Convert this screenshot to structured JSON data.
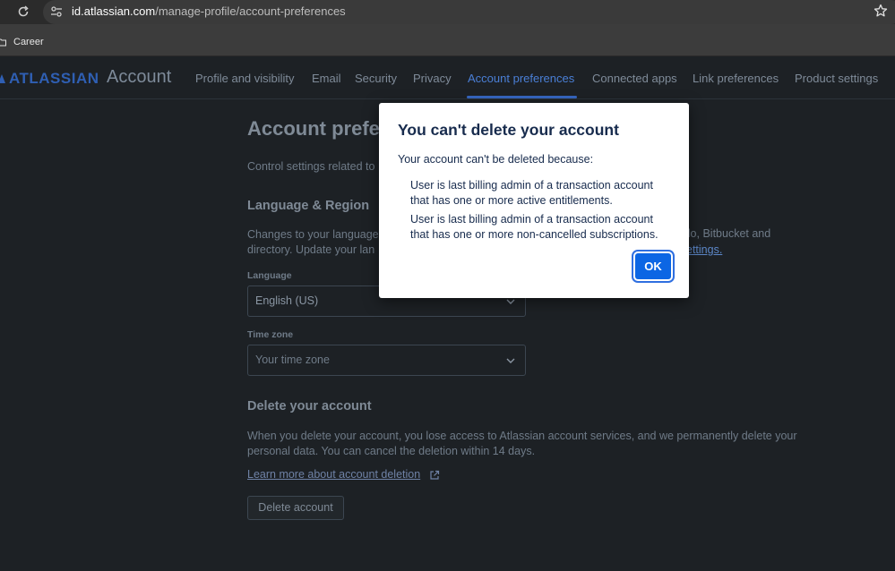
{
  "browser": {
    "url_host": "id.atlassian.com",
    "url_path": "/manage-profile/account-preferences",
    "bookmark": "Career"
  },
  "nav": {
    "logo_word": "ATLASSIAN",
    "logo_product": "Account",
    "items": [
      "Profile and visibility",
      "Email",
      "Security",
      "Privacy",
      "Account preferences",
      "Connected apps",
      "Link preferences",
      "Product settings"
    ],
    "active_index": 4
  },
  "page": {
    "title": "Account prefer",
    "description": "Control settings related to",
    "language_region": {
      "title": "Language & Region",
      "line1": "Changes to your language",
      "line1_right": "llo, Bitbucket and",
      "line2": "directory. Update your lan",
      "line2_right_link": "ettings.",
      "language_label": "Language",
      "language_value": "English (US)",
      "timezone_label": "Time zone",
      "timezone_placeholder": "Your time zone"
    },
    "delete": {
      "title": "Delete your account",
      "line1": "When you delete your account, you lose access to Atlassian account services, and we permanently delete your",
      "line2": "personal data. You can cancel the deletion within 14 days.",
      "learn_more": "Learn more about account deletion",
      "button": "Delete account"
    }
  },
  "modal": {
    "title": "You can't delete your account",
    "intro": "Your account can't be deleted because:",
    "reasons": [
      {
        "line1": "User is last billing admin of a transaction account",
        "line2": "that has one or more active entitlements."
      },
      {
        "line1": "User is last billing admin of a transaction account",
        "line2": "that has one or more non-cancelled subscriptions."
      }
    ],
    "ok": "OK"
  },
  "colors": {
    "background": "#1d2125",
    "accent": "#0c66e4",
    "active_tab": "#4a7fd6"
  }
}
